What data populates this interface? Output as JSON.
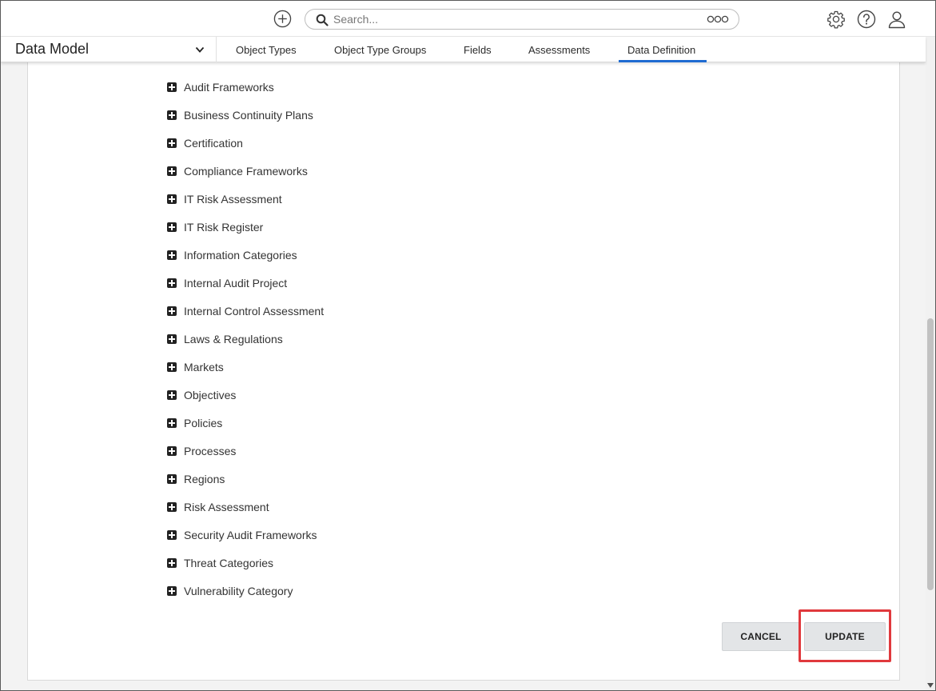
{
  "topbar": {
    "search_placeholder": "Search...",
    "icons": [
      "add-circle-icon",
      "search-icon",
      "more-options-icon",
      "gear-icon",
      "help-icon",
      "user-icon"
    ]
  },
  "subheader": {
    "module_title": "Data Model",
    "tabs": [
      {
        "label": "Object Types",
        "active": false
      },
      {
        "label": "Object Type Groups",
        "active": false
      },
      {
        "label": "Fields",
        "active": false
      },
      {
        "label": "Assessments",
        "active": false
      },
      {
        "label": "Data Definition",
        "active": true
      }
    ]
  },
  "tree": {
    "items": [
      "Audit Frameworks",
      "Business Continuity Plans",
      "Certification",
      "Compliance Frameworks",
      "IT Risk Assessment",
      "IT Risk Register",
      "Information Categories",
      "Internal Audit Project",
      "Internal Control Assessment",
      "Laws & Regulations",
      "Markets",
      "Objectives",
      "Policies",
      "Processes",
      "Regions",
      "Risk Assessment",
      "Security Audit Frameworks",
      "Threat Categories",
      "Vulnerability Category"
    ]
  },
  "actions": {
    "cancel_label": "CANCEL",
    "update_label": "UPDATE"
  },
  "colors": {
    "accent": "#1f6bd1",
    "highlight": "#e0393d",
    "button_bg": "#e3e5e7"
  }
}
